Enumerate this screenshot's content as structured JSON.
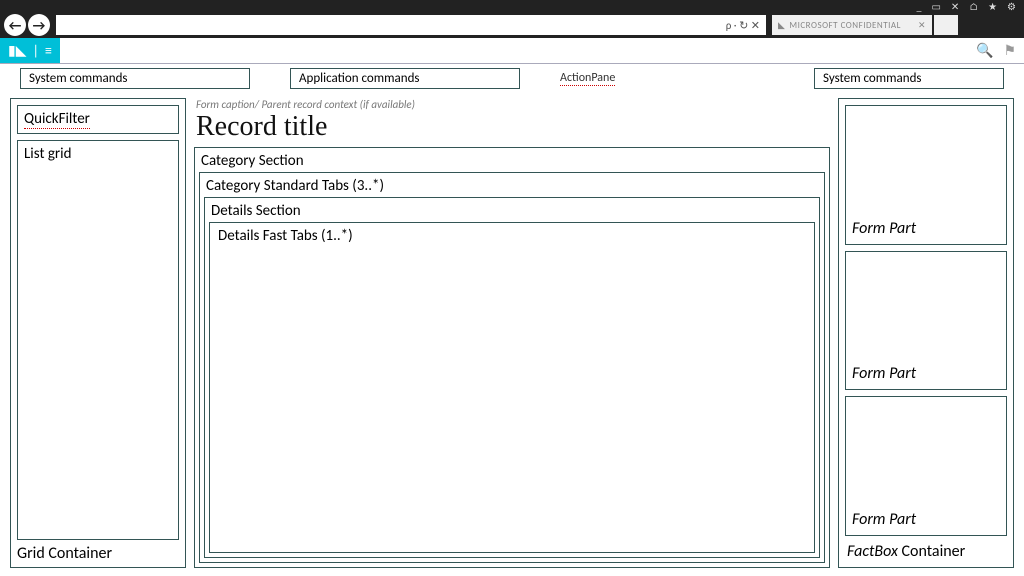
{
  "chrome": {
    "icons": [
      "_",
      "▭",
      "✕",
      "⌂",
      "★",
      "⚙"
    ]
  },
  "browser": {
    "back": "←",
    "fwd": "→",
    "addr_suffix": "ρ · ↻ ✕",
    "tab_label": "MICROSOFT CONFIDENTIAL",
    "tab_close": "✕",
    "right_icons": [
      "⌂",
      "★",
      "⚙"
    ]
  },
  "ribbon": {
    "brand_logo": "▮◣",
    "brand_div": "|",
    "brand_menu": "≡",
    "search_icon": "🔍",
    "flag_icon": "⚑"
  },
  "actionpane": {
    "left_cmd": "System commands",
    "app_cmd": "Application commands",
    "title": "ActionPane",
    "right_cmd": "System commands"
  },
  "left": {
    "quickfilter": "QuickFilter",
    "listgrid": "List grid",
    "gridcontainer": "Grid Container"
  },
  "mid": {
    "caption": "Form caption/ Parent record context (if available)",
    "title": "Record title",
    "category_section": "Category Section",
    "category_tabs": "Category Standard Tabs (3..*)",
    "details_section": "Details Section",
    "fast_tabs": "Details Fast Tabs (1..*)"
  },
  "right": {
    "formpart": "Form Part",
    "factbox_prefix": "FactBox",
    "factbox_suffix": " Container"
  }
}
